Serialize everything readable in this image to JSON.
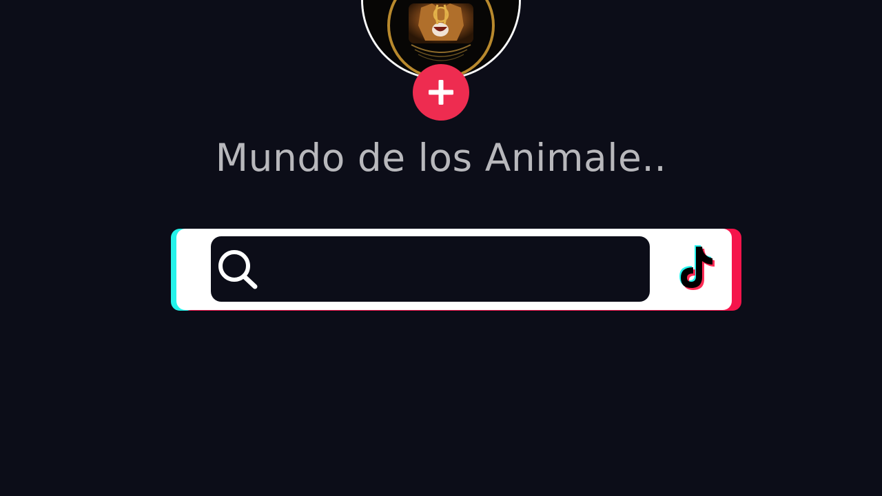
{
  "profile": {
    "display_name": "Mundo de los Animale..",
    "avatar_icon": "lion-logo-icon",
    "follow_icon": "plus-icon"
  },
  "search": {
    "query": "",
    "search_icon": "search-icon",
    "brand_icon": "tiktok-logo-icon"
  },
  "colors": {
    "background": "#0c0d18",
    "follow_button": "#ee2c50",
    "accent_cyan": "#24f3ea",
    "accent_red": "#f5144b",
    "username_text": "#b8b8bc"
  }
}
